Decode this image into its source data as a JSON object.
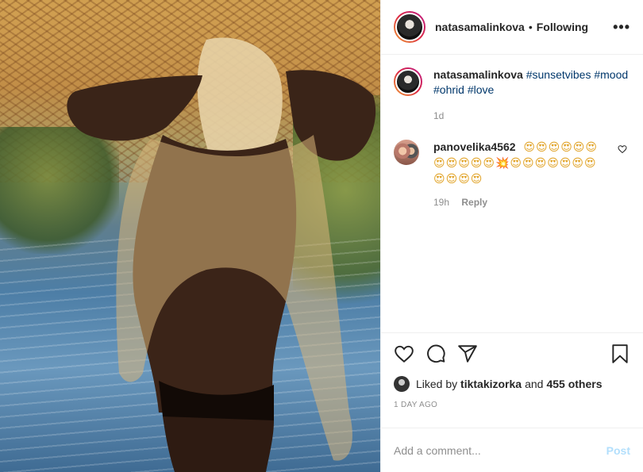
{
  "header": {
    "username": "natasamalinkova",
    "separator": "•",
    "follow_status": "Following",
    "more_label": "•••"
  },
  "caption": {
    "username": "natasamalinkova",
    "tags": [
      "#sunsetvibes",
      "#mood",
      "#ohrid",
      "#love"
    ],
    "time": "1d"
  },
  "comment": {
    "username": "panovelika4562",
    "emojis": "😍😍😍😍😍😍😍😍😍😍😍💥😍😍😍😍😍😍😍😍😍😍😍",
    "time": "19h",
    "reply_label": "Reply"
  },
  "actions": {
    "like_icon": "heart-icon",
    "comment_icon": "comment-icon",
    "share_icon": "share-icon",
    "save_icon": "bookmark-icon"
  },
  "likes": {
    "prefix": "Liked by",
    "user": "tiktakizorka",
    "and": "and",
    "others": "455 others"
  },
  "post_time": "1 DAY AGO",
  "add_comment": {
    "placeholder": "Add a comment...",
    "post_label": "Post"
  },
  "colors": {
    "text": "#262626",
    "muted": "#8e8e8e",
    "hashtag": "#00376b",
    "post_disabled": "#b2dffc",
    "border": "#efefef"
  }
}
